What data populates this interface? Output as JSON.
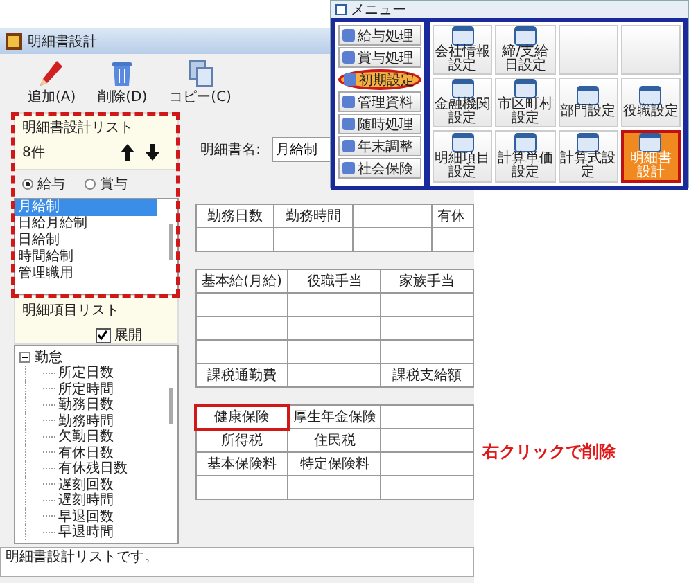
{
  "main_window": {
    "title": "明細書設計",
    "toolbar": [
      {
        "kind": "add",
        "label": "追加(A)"
      },
      {
        "kind": "delete",
        "label": "削除(D)"
      },
      {
        "kind": "copy",
        "label": "コピー(C)"
      }
    ],
    "design_list": {
      "title": "明細書設計リスト",
      "count": "8件",
      "radios": [
        {
          "label": "給与",
          "selected": true
        },
        {
          "label": "賞与",
          "selected": false
        }
      ],
      "items": [
        {
          "label": "月給制",
          "selected": true
        },
        {
          "label": "日給月給制",
          "selected": false
        },
        {
          "label": "日給制",
          "selected": false
        },
        {
          "label": "時間給制",
          "selected": false
        },
        {
          "label": "管理職用",
          "selected": false
        }
      ]
    },
    "item_list": {
      "title": "明細項目リスト",
      "expand": {
        "label": "展開",
        "checked": true
      },
      "tree": [
        {
          "label": "勤怠",
          "expanded": true,
          "children": [
            {
              "label": "所定日数"
            },
            {
              "label": "所定時間"
            },
            {
              "label": "勤務日数"
            },
            {
              "label": "勤務時間"
            },
            {
              "label": "欠勤日数"
            },
            {
              "label": "有休日数"
            },
            {
              "label": "有休残日数"
            },
            {
              "label": "遅刻回数"
            },
            {
              "label": "遅刻時間"
            },
            {
              "label": "早退回数"
            },
            {
              "label": "早退時間"
            }
          ]
        }
      ]
    },
    "form": {
      "name_label": "明細書名:",
      "name_value": "月給制",
      "tables": [
        {
          "rows": [
            [
              {
                "text": "勤務日数",
                "marked": false
              },
              {
                "text": "勤務時間",
                "marked": false
              },
              {
                "marked": false
              },
              {
                "text": "有休",
                "marked": false
              }
            ],
            [
              {
                "marked": false
              },
              {
                "marked": false
              },
              {
                "marked": false
              },
              {
                "marked": false
              }
            ]
          ]
        },
        {
          "rows": [
            [
              {
                "text": "基本給(月給)",
                "marked": false
              },
              {
                "text": "役職手当",
                "marked": false
              },
              {
                "text": "家族手当",
                "marked": false
              }
            ],
            [
              {
                "marked": false
              },
              {
                "marked": false
              },
              {
                "marked": false
              }
            ],
            [
              {
                "marked": false
              },
              {
                "marked": false
              },
              {
                "marked": false
              }
            ],
            [
              {
                "marked": false
              },
              {
                "marked": false
              },
              {
                "marked": false
              }
            ],
            [
              {
                "text": "課税通勤費",
                "marked": false
              },
              {
                "marked": false
              },
              {
                "text": "課税支給額",
                "marked": false
              }
            ]
          ]
        },
        {
          "rows": [
            [
              {
                "text": "健康保険",
                "marked": true
              },
              {
                "text": "厚生年金保険",
                "marked": false
              },
              {
                "marked": false
              }
            ],
            [
              {
                "text": "所得税",
                "marked": false
              },
              {
                "text": "住民税",
                "marked": false
              },
              {
                "marked": false
              }
            ],
            [
              {
                "text": "基本保険料",
                "marked": false
              },
              {
                "text": "特定保険料",
                "marked": false
              },
              {
                "marked": false
              }
            ],
            [
              {
                "marked": false
              },
              {
                "marked": false
              },
              {
                "marked": false
              }
            ]
          ]
        }
      ]
    },
    "annotation": "右クリックで削除",
    "status_bar": "明細書設計リストです。"
  },
  "menu_window": {
    "title": "メニュー",
    "categories": [
      {
        "label": "給与処理",
        "selected": false
      },
      {
        "label": "賞与処理",
        "selected": false
      },
      {
        "label": "初期設定",
        "selected": true
      },
      {
        "label": "管理資料",
        "selected": false
      },
      {
        "label": "随時処理",
        "selected": false
      },
      {
        "label": "年末調整",
        "selected": false
      },
      {
        "label": "社会保険",
        "selected": false
      }
    ],
    "tiles": [
      {
        "label": "会社情報設定",
        "selected": false
      },
      {
        "label": "締/支給日設定",
        "selected": false
      },
      {
        "selected": false
      },
      {
        "selected": false
      },
      {
        "label": "金融機関設定",
        "selected": false
      },
      {
        "label": "市区町村設定",
        "selected": false
      },
      {
        "label": "部門設定",
        "selected": false
      },
      {
        "label": "役職設定",
        "selected": false
      },
      {
        "label": "明細項目設定",
        "selected": false
      },
      {
        "label": "計算単価設定",
        "selected": false
      },
      {
        "label": "計算式設定",
        "selected": false
      },
      {
        "label": "明細書設計",
        "selected": true
      }
    ]
  }
}
